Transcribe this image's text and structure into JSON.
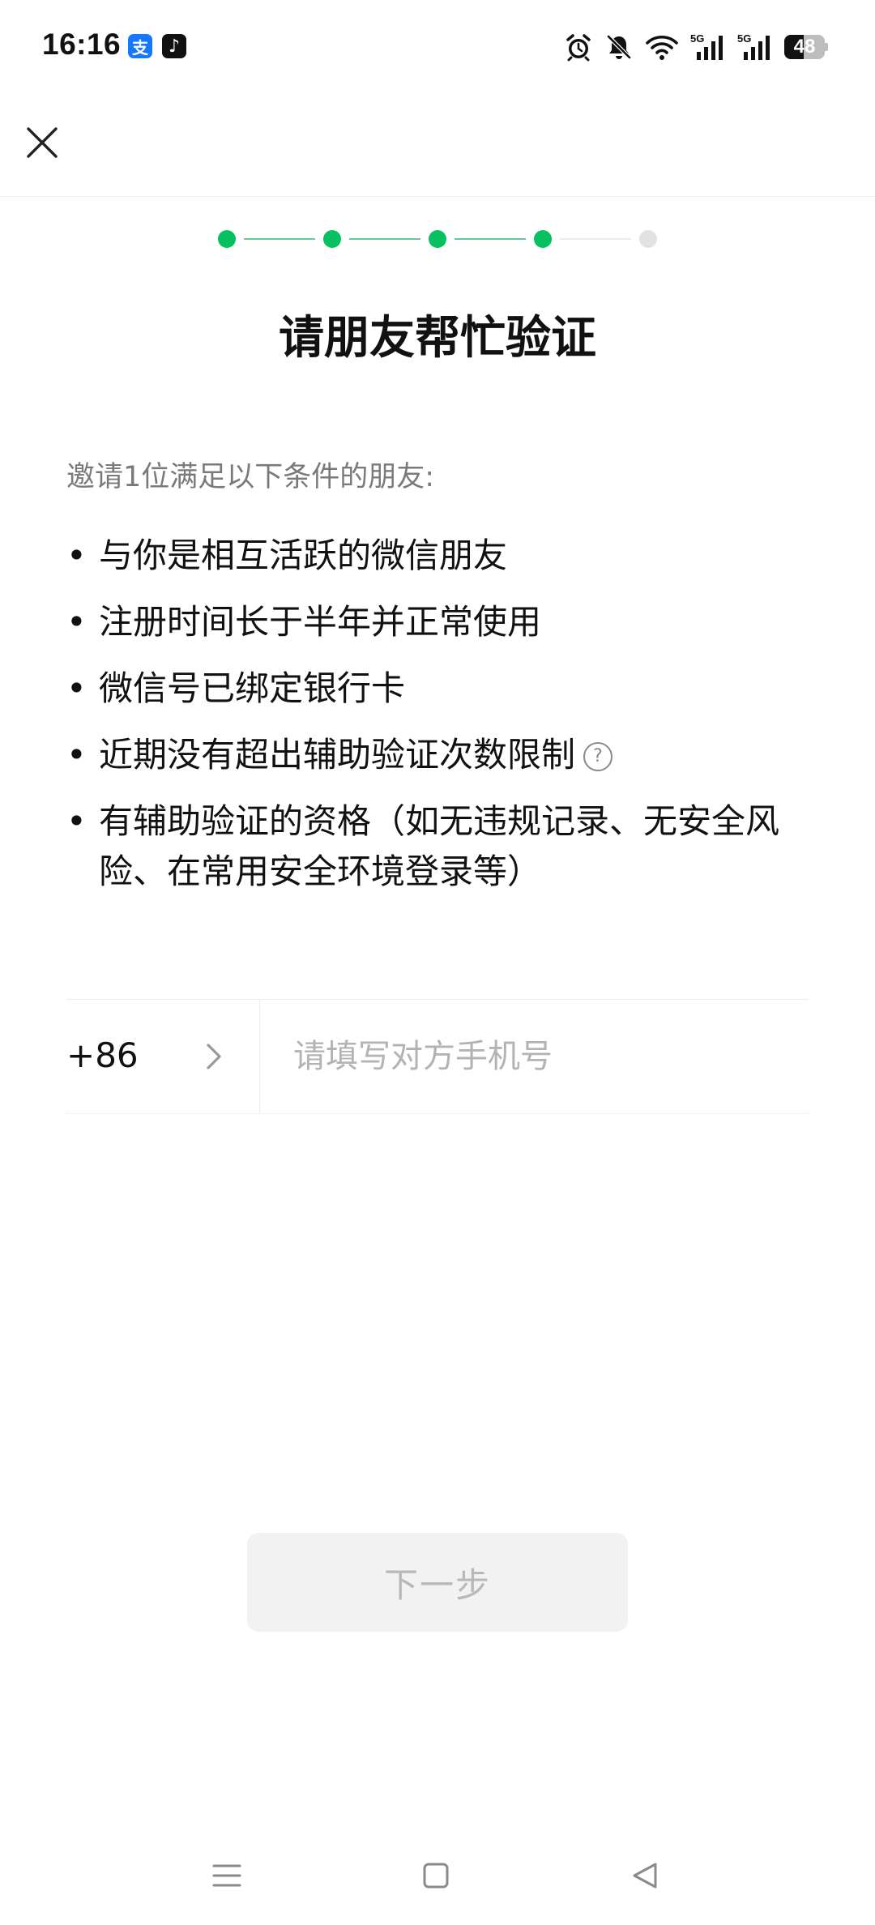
{
  "status_bar": {
    "time": "16:16",
    "apps": [
      {
        "name": "alipay-icon",
        "glyph": "支"
      },
      {
        "name": "tiktok-icon",
        "glyph": "♪"
      }
    ],
    "icons": [
      "alarm-icon",
      "mute-bell-icon",
      "wifi-icon",
      "signal-5g-icon",
      "signal-5g-icon"
    ],
    "network_label_1": "5G",
    "network_label_2": "5G",
    "battery_percent": 48,
    "battery_text": "48"
  },
  "header": {
    "close_icon": "close-icon"
  },
  "steps": {
    "total": 5,
    "current": 4,
    "active_color": "#07c160",
    "inactive_color": "#e2e2e2"
  },
  "title": "请朋友帮忙验证",
  "intro": "邀请1位满足以下条件的朋友:",
  "conditions": [
    {
      "bullet": "•",
      "text": "与你是相互活跃的微信朋友"
    },
    {
      "bullet": "•",
      "text": "注册时间长于半年并正常使用"
    },
    {
      "bullet": "•",
      "text": "微信号已绑定银行卡"
    },
    {
      "bullet": "•",
      "text": "近期没有超出辅助验证次数限制",
      "help_glyph": "?"
    },
    {
      "bullet": "•",
      "text": "有辅助验证的资格（如无违规记录、无安全风险、在常用安全环境登录等）"
    }
  ],
  "phone": {
    "country_code": "+86",
    "value": "",
    "placeholder": "请填写对方手机号"
  },
  "next_button": {
    "label": "下一步",
    "enabled": false
  },
  "nav": {
    "icons": [
      "menu-icon",
      "home-icon",
      "back-icon"
    ]
  }
}
